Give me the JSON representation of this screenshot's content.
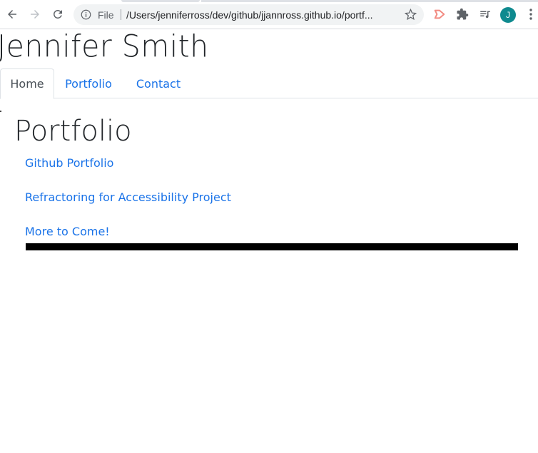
{
  "browser": {
    "omnibox": {
      "scheme_label": "File",
      "url": "/Users/jenniferross/dev/github/jjannross.github.io/portf..."
    },
    "profile_initial": "J"
  },
  "site": {
    "title": "Jennifer Smith",
    "tabs": [
      {
        "label": "Home",
        "active": true
      },
      {
        "label": "Portfolio",
        "active": false
      },
      {
        "label": "Contact",
        "active": false
      }
    ]
  },
  "main": {
    "heading": "Portfolio",
    "links": [
      {
        "label": "Github Portfolio"
      },
      {
        "label": "Refractoring for Accessibility Project"
      },
      {
        "label": "More to Come!"
      }
    ]
  },
  "colors": {
    "link": "#1a73e8",
    "avatar": "#0f8a8f",
    "bar": "#000000"
  }
}
